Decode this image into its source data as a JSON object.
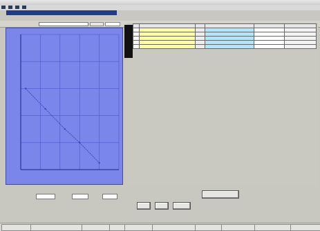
{
  "menu": {
    "items": [
      "",
      "",
      "",
      ""
    ]
  },
  "toolbar": {
    "label": "",
    "combo_value": "",
    "fit_button": "",
    "check_label": ""
  },
  "table": {
    "headers": [
      "",
      "",
      "",
      "",
      "",
      ""
    ],
    "rows": [
      [
        "",
        "",
        "",
        "",
        "",
        ""
      ],
      [
        "",
        "",
        "",
        "",
        "",
        ""
      ],
      [
        "",
        "",
        "",
        "",
        "",
        ""
      ],
      [
        "",
        "",
        "",
        "",
        "",
        ""
      ],
      [
        "",
        "",
        "",
        "",
        "",
        ""
      ]
    ]
  },
  "controls": {
    "param_label": "",
    "field2_label": "",
    "field3_label": "",
    "action_button": "",
    "small_buttons": [
      "",
      "",
      ""
    ]
  },
  "status": {
    "fields": [
      "",
      "",
      "",
      "",
      "",
      "",
      "",
      "",
      "",
      ""
    ]
  },
  "chart_data": {
    "type": "line",
    "title": "",
    "xlabel": "",
    "ylabel": "",
    "x": [
      0.05,
      0.25,
      0.45,
      0.6,
      0.8
    ],
    "series": [
      {
        "values": [
          0.6,
          0.45,
          0.3,
          0.2,
          0.05
        ]
      }
    ],
    "xlim": [
      0,
      1
    ],
    "ylim": [
      0,
      1
    ],
    "grid": true,
    "colors": {
      "background": "#7b86ea",
      "line": "#3a44b8",
      "grid": "#4b56c9"
    }
  }
}
